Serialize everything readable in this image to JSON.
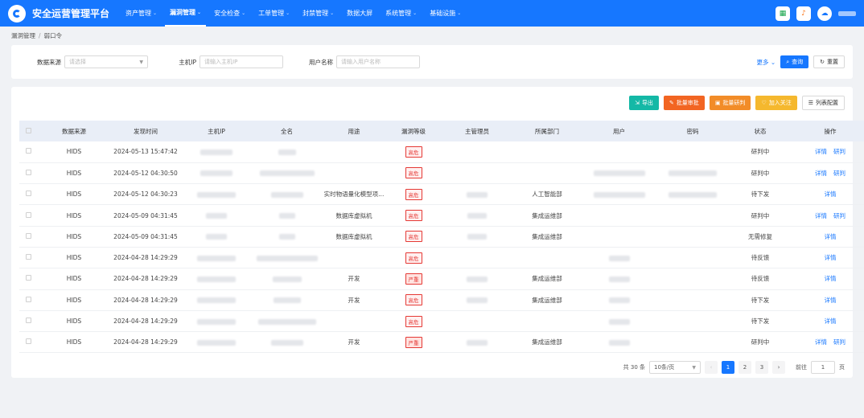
{
  "app": {
    "title": "安全运营管理平台"
  },
  "nav": [
    {
      "label": "资产管理",
      "dropdown": true,
      "active": false
    },
    {
      "label": "漏洞管理",
      "dropdown": true,
      "active": true
    },
    {
      "label": "安全检查",
      "dropdown": true,
      "active": false
    },
    {
      "label": "工单管理",
      "dropdown": true,
      "active": false
    },
    {
      "label": "封禁管理",
      "dropdown": true,
      "active": false
    },
    {
      "label": "数据大屏",
      "dropdown": false,
      "active": false
    },
    {
      "label": "系统管理",
      "dropdown": true,
      "active": false
    },
    {
      "label": "基础设施",
      "dropdown": true,
      "active": false
    }
  ],
  "breadcrumb": [
    "漏洞管理",
    "弱口令"
  ],
  "filter": {
    "source_label": "数据来源",
    "source_placeholder": "请选择",
    "host_label": "主机IP",
    "host_placeholder": "请输入主机IP",
    "user_label": "用户名称",
    "user_placeholder": "请输入用户名称",
    "more_label": "更多",
    "query_label": "查询",
    "reset_label": "重置"
  },
  "toolbar": {
    "export": "导出",
    "batch_approve": "批量审批",
    "batch_judge": "批量研判",
    "follow": "加入关注",
    "columns": "列表配置"
  },
  "table": {
    "headers": [
      "数据来源",
      "发现时间",
      "主机IP",
      "全名",
      "用途",
      "漏洞等级",
      "主管理员",
      "所属部门",
      "用户",
      "密码",
      "状态",
      "操作"
    ],
    "rows": [
      {
        "source": "HIDS",
        "time": "2024-05-13 15:47:42",
        "purpose": "",
        "level": "高危",
        "severe": false,
        "dept": "",
        "status": "研判中",
        "ops": [
          "详情",
          "研判"
        ]
      },
      {
        "source": "HIDS",
        "time": "2024-05-12 04:30:50",
        "purpose": "",
        "level": "高危",
        "severe": false,
        "dept": "",
        "status": "研判中",
        "ops": [
          "详情",
          "研判"
        ]
      },
      {
        "source": "HIDS",
        "time": "2024-05-12 04:30:23",
        "purpose": "实时物语量化模型项...",
        "level": "高危",
        "severe": false,
        "dept": "人工智能部",
        "status": "待下发",
        "ops": [
          "详情"
        ]
      },
      {
        "source": "HIDS",
        "time": "2024-05-09 04:31:45",
        "purpose": "数据库虚拟机",
        "level": "高危",
        "severe": false,
        "dept": "集成运维部",
        "status": "研判中",
        "ops": [
          "详情",
          "研判"
        ]
      },
      {
        "source": "HIDS",
        "time": "2024-05-09 04:31:45",
        "purpose": "数据库虚拟机",
        "level": "高危",
        "severe": false,
        "dept": "集成运维部",
        "status": "无需修复",
        "ops": [
          "详情"
        ]
      },
      {
        "source": "HIDS",
        "time": "2024-04-28 14:29:29",
        "purpose": "",
        "level": "高危",
        "severe": false,
        "dept": "",
        "status": "待反馈",
        "ops": [
          "详情"
        ]
      },
      {
        "source": "HIDS",
        "time": "2024-04-28 14:29:29",
        "purpose": "开发",
        "level": "严重",
        "severe": true,
        "dept": "集成运维部",
        "status": "待反馈",
        "ops": [
          "详情"
        ]
      },
      {
        "source": "HIDS",
        "time": "2024-04-28 14:29:29",
        "purpose": "开发",
        "level": "高危",
        "severe": false,
        "dept": "集成运维部",
        "status": "待下发",
        "ops": [
          "详情"
        ]
      },
      {
        "source": "HIDS",
        "time": "2024-04-28 14:29:29",
        "purpose": "",
        "level": "高危",
        "severe": false,
        "dept": "",
        "status": "待下发",
        "ops": [
          "详情"
        ]
      },
      {
        "source": "HIDS",
        "time": "2024-04-28 14:29:29",
        "purpose": "开发",
        "level": "严重",
        "severe": true,
        "dept": "集成运维部",
        "status": "研判中",
        "ops": [
          "详情",
          "研判"
        ]
      }
    ]
  },
  "pagination": {
    "total": "共 30 条",
    "page_size": "10条/页",
    "pages": [
      "1",
      "2",
      "3"
    ],
    "current": "1",
    "goto_label": "前往",
    "goto_value": "1",
    "page_unit": "页"
  }
}
